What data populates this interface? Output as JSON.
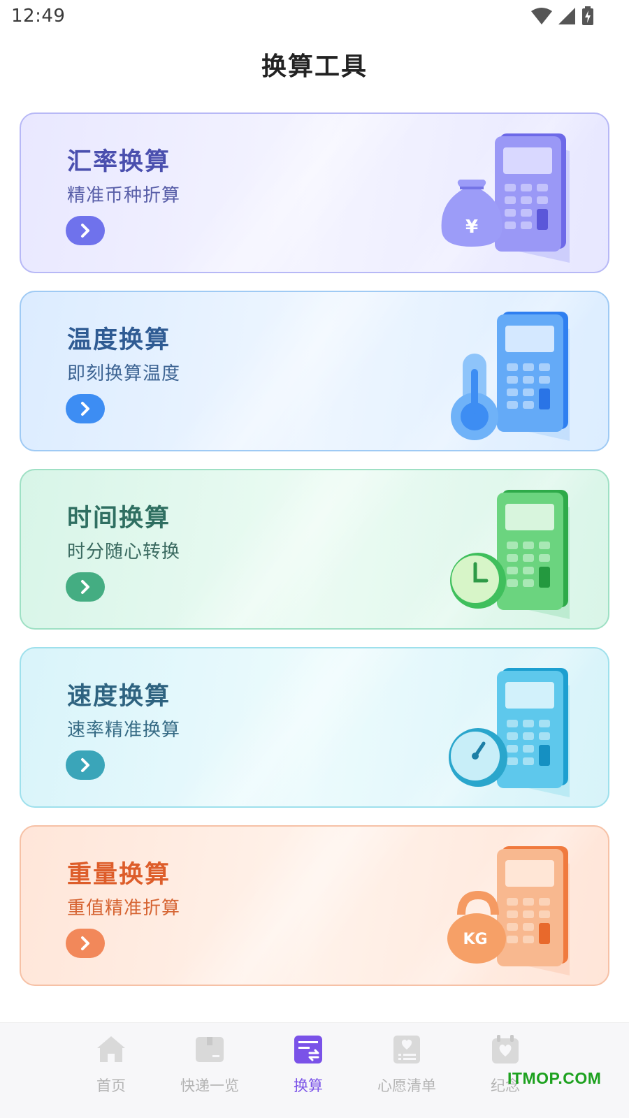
{
  "status_bar": {
    "time": "12:49"
  },
  "page": {
    "title": "换算工具"
  },
  "cards": [
    {
      "title": "汇率换算",
      "subtitle": "精准币种折算",
      "icon": "money-bag-calculator",
      "accent": "#6f72ec",
      "symbol": "¥"
    },
    {
      "title": "温度换算",
      "subtitle": "即刻换算温度",
      "icon": "thermometer-calculator",
      "accent": "#3d8df3"
    },
    {
      "title": "时间换算",
      "subtitle": "时分随心转换",
      "icon": "clock-calculator",
      "accent": "#44ad82"
    },
    {
      "title": "速度换算",
      "subtitle": "速率精准换算",
      "icon": "speedometer-calculator",
      "accent": "#3aa5b9"
    },
    {
      "title": "重量换算",
      "subtitle": "重值精准折算",
      "icon": "kettlebell-calculator",
      "accent": "#f2885a",
      "symbol": "KG"
    }
  ],
  "bottom_nav": {
    "items": [
      {
        "label": "首页",
        "icon": "home-icon",
        "active": false
      },
      {
        "label": "快递一览",
        "icon": "package-icon",
        "active": false
      },
      {
        "label": "换算",
        "icon": "convert-icon",
        "active": true
      },
      {
        "label": "心愿清单",
        "icon": "wishlist-icon",
        "active": false
      },
      {
        "label": "纪念",
        "icon": "anniversary-icon",
        "active": false
      }
    ],
    "active_color": "#7a52e8",
    "inactive_color": "#b4b4b4"
  },
  "watermark": "ITMOP.COM"
}
